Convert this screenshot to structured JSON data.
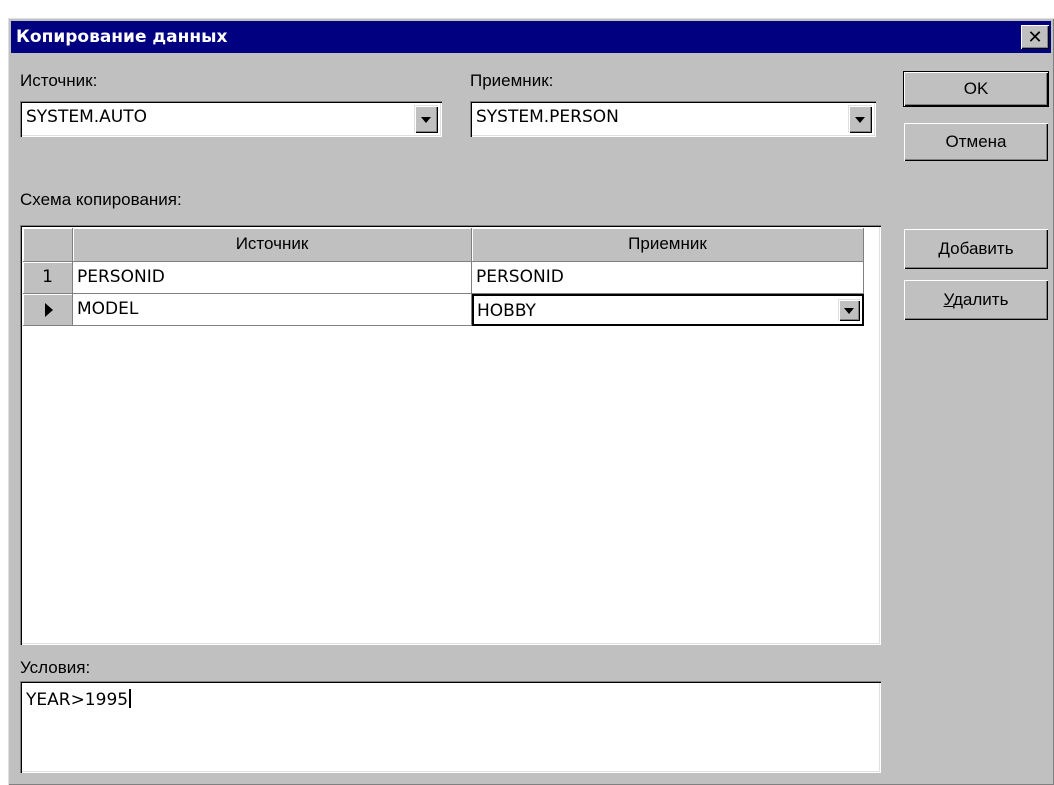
{
  "window": {
    "title": "Копирование данных",
    "close_label": "✕"
  },
  "source": {
    "label": "Источник:",
    "value": "SYSTEM.AUTO"
  },
  "target": {
    "label": "Приемник:",
    "value": "SYSTEM.PERSON"
  },
  "buttons": {
    "ok": "OK",
    "cancel": "Отмена",
    "add_hotkey": "Д",
    "add_rest": "обавить",
    "delete_hotkey": "У",
    "delete_rest": "далить"
  },
  "mapping": {
    "label": "Схема копирования:",
    "columns": [
      "Источник",
      "Приемник"
    ],
    "rows": [
      {
        "indicator": "1",
        "source": "PERSONID",
        "target": "PERSONID"
      },
      {
        "indicator": "current-row-arrow",
        "source": "MODEL",
        "target": "HOBBY"
      }
    ]
  },
  "conditions": {
    "label": "Условия:",
    "value": "YEAR>1995"
  },
  "icons": {
    "close": "close-icon",
    "dropdown": "dropdown-arrow-icon",
    "row_pointer": "row-pointer-icon"
  },
  "colors": {
    "titlebar": "#000080",
    "face": "#c0c0c0",
    "window": "#ffffff"
  }
}
